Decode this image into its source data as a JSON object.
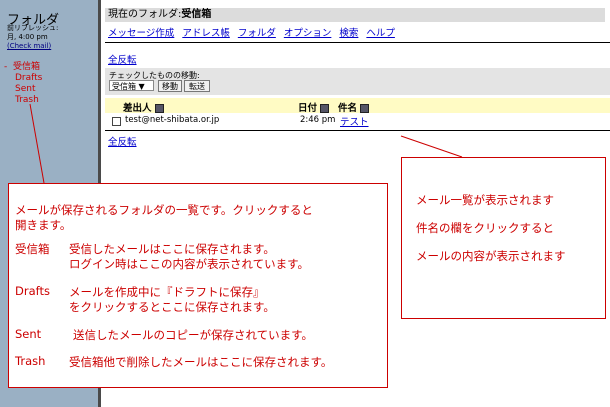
{
  "sidebar": {
    "title": "フォルダ",
    "refresh_label": "前リフレッシュ:",
    "refresh_time": "月, 4:00 pm",
    "check_mail": "(Check mail)",
    "folders": [
      {
        "marker": "-",
        "label": "受信箱"
      },
      {
        "label": "Drafts"
      },
      {
        "label": "Sent"
      },
      {
        "label": "Trash"
      }
    ]
  },
  "topbar": {
    "current_folder_label": "現在のフォルダ:",
    "current_folder": "受信箱"
  },
  "menu": [
    "メッセージ作成",
    "アドレス帳",
    "フォルダ",
    "オプション",
    "検索",
    "ヘルプ"
  ],
  "toggle_all": "全反転",
  "move": {
    "label": "チェックしたものの移動:",
    "selected_folder": "受信箱 ▼",
    "move_button": "移動",
    "forward_button": "転送"
  },
  "table": {
    "headers": {
      "from": "差出人",
      "date": "日付",
      "subject": "件名"
    },
    "rows": [
      {
        "from": "test@net-shibata.or.jp",
        "date": "2:46 pm",
        "subject": "テスト"
      }
    ]
  },
  "callout_left": {
    "intro1": "メールが保存されるフォルダの一覧です。クリックすると",
    "intro2": "開きます。",
    "items": [
      {
        "term": "受信箱",
        "line1": "受信したメールはここに保存されます。",
        "line2": "ログイン時はここの内容が表示されています。"
      },
      {
        "term": "Drafts",
        "line1": "メールを作成中に『ドラフトに保存』",
        "line2": "をクリックするとここに保存されます。"
      },
      {
        "term": "Sent",
        "line1": "送信したメールのコピーが保存されています。"
      },
      {
        "term": "Trash",
        "line1": "受信箱他で削除したメールはここに保存されます。"
      }
    ]
  },
  "callout_right": {
    "lines": [
      "メール一覧が表示されます",
      "件名の欄をクリックすると",
      "メールの内容が表示されます"
    ]
  },
  "colors": {
    "sidebar_bg": "#9ab0c4",
    "callout_red": "#cc0000",
    "link_blue": "#0000cc",
    "header_yellow": "#fffbc4"
  }
}
